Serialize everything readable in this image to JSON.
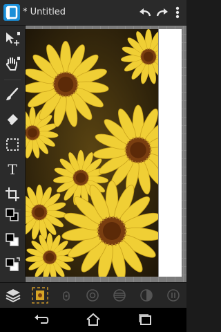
{
  "header": {
    "doc_title": "* Untitled",
    "icons": [
      "app-logo",
      "undo-icon",
      "redo-icon",
      "overflow-menu-icon"
    ]
  },
  "toolbar": {
    "tools": [
      "move-select-icon",
      "hand-pan-icon",
      "brush-icon",
      "eraser-icon",
      "marquee-select-icon",
      "text-tool-icon",
      "crop-icon",
      "fill-color-icon",
      "stroke-color-icon",
      "swap-colors-icon"
    ],
    "text_tool_glyph": "T"
  },
  "bottom_bar": {
    "icons": [
      "layers-icon",
      "image-adjust-icon",
      "lock-icon",
      "target-icon",
      "stripes-icon",
      "contrast-icon",
      "pause-icon"
    ]
  },
  "nav": {
    "icons": [
      "back-icon",
      "home-icon",
      "recent-apps-icon"
    ]
  },
  "colors": {
    "accent": "#1a8fd8",
    "petal": "#f2d33a",
    "center": "#7a3e10"
  }
}
